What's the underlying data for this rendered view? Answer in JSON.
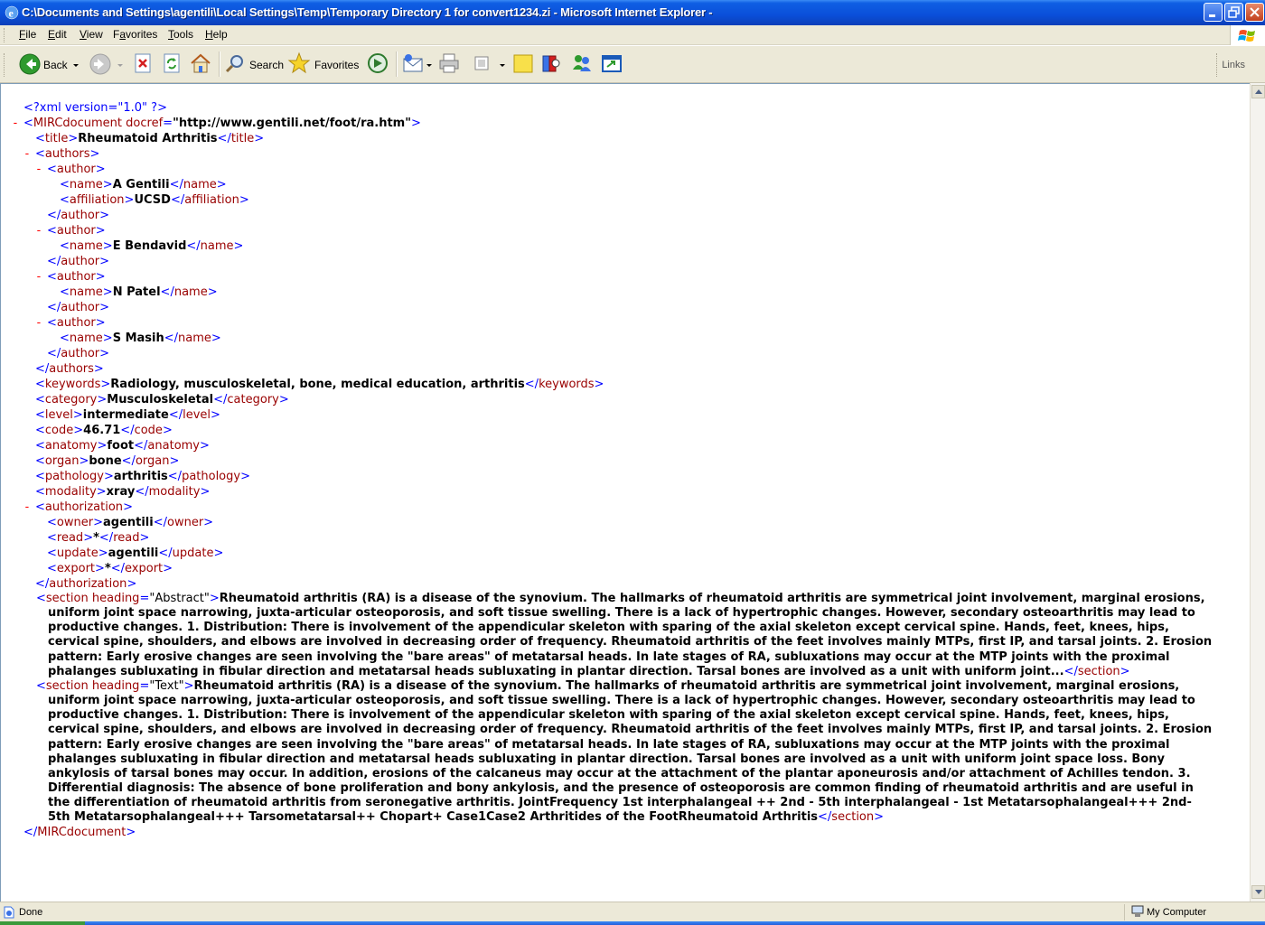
{
  "window": {
    "title": "C:\\Documents and Settings\\agentili\\Local Settings\\Temp\\Temporary Directory 1 for convert1234.zi - Microsoft Internet Explorer",
    "title_short": "C:\\Documents and Settings\\agentili\\Local Settings\\Temp\\Temporary Directory 1 for convert1234.zi - Microsoft Internet Explorer -",
    "icon": "ie-icon"
  },
  "menu": {
    "file": {
      "hot": "F",
      "rest": "ile"
    },
    "edit": {
      "hot": "E",
      "rest": "dit"
    },
    "view": {
      "hot": "V",
      "rest": "iew"
    },
    "favorites": {
      "pre": "F",
      "hot": "a",
      "rest": "vorites"
    },
    "tools": {
      "hot": "T",
      "rest": "ools"
    },
    "help": {
      "hot": "H",
      "rest": "elp"
    }
  },
  "toolbar": {
    "back": "Back",
    "search": "Search",
    "favorites": "Favorites",
    "links": "Links"
  },
  "status": {
    "text": "Done",
    "zone": "My Computer"
  },
  "xml": {
    "decl": "<?xml version=\"1.0\" ?>",
    "root_open_tag": "MIRCdocument",
    "root_attr": "docref",
    "root_attr_value": "\"http://www.gentili.net/foot/ra.htm\"",
    "title": "Rheumatoid Arthritis",
    "authors": [
      {
        "name": "A Gentili",
        "affiliation": "UCSD"
      },
      {
        "name": "E Bendavid"
      },
      {
        "name": "N Patel"
      },
      {
        "name": "S Masih"
      }
    ],
    "keywords": "Radiology, musculoskeletal, bone, medical education, arthritis",
    "category": "Musculoskeletal",
    "level": "intermediate",
    "code": "46.71",
    "anatomy": "foot",
    "organ": "bone",
    "pathology": "arthritis",
    "modality": "xray",
    "authorization": {
      "owner": "agentili",
      "read": "*",
      "update": "agentili",
      "export": "*"
    },
    "sections": [
      {
        "heading": "\"Abstract\"",
        "text": "Rheumatoid arthritis (RA) is a disease of the synovium. The hallmarks of rheumatoid arthritis are symmetrical joint involvement, marginal erosions, uniform joint space narrowing, juxta-articular osteoporosis, and soft tissue swelling. There is a lack of hypertrophic changes. However, secondary osteoarthritis may lead to productive changes. 1. Distribution: There is involvement of the appendicular skeleton with sparing of the axial skeleton except cervical spine. Hands, feet, knees, hips, cervical spine, shoulders, and elbows are involved in decreasing order of frequency. Rheumatoid arthritis of the feet involves mainly MTPs, first IP, and tarsal joints. 2. Erosion pattern: Early erosive changes are seen involving the \"bare areas\" of metatarsal heads. In late stages of RA, subluxations may occur at the MTP joints with the proximal phalanges subluxating in fibular direction and metatarsal heads subluxating in plantar direction. Tarsal bones are involved as a unit with uniform joint..."
      },
      {
        "heading": "\"Text\"",
        "text": "Rheumatoid arthritis (RA) is a disease of the synovium. The hallmarks of rheumatoid arthritis are symmetrical joint involvement, marginal erosions, uniform joint space narrowing, juxta-articular osteoporosis, and soft tissue swelling. There is a lack of hypertrophic changes. However, secondary osteoarthritis may lead to productive changes. 1. Distribution: There is involvement of the appendicular skeleton with sparing of the axial skeleton except cervical spine. Hands, feet, knees, hips, cervical spine, shoulders, and elbows are involved in decreasing order of frequency. Rheumatoid arthritis of the feet involves mainly MTPs, first IP, and tarsal joints. 2. Erosion pattern: Early erosive changes are seen involving the \"bare areas\" of metatarsal heads. In late stages of RA, subluxations may occur at the MTP joints with the proximal phalanges subluxating in fibular direction and metatarsal heads subluxating in plantar direction. Tarsal bones are involved as a unit with uniform joint space loss. Bony ankylosis of tarsal bones may occur. In addition, erosions of the calcaneus may occur at the attachment of the plantar aponeurosis and/or attachment of Achilles tendon. 3. Differential diagnosis: The absence of bone proliferation and bony ankylosis, and the presence of osteoporosis are common finding of rheumatoid arthritis and are useful in the differentiation of rheumatoid arthritis from seronegative arthritis. JointFrequency 1st interphalangeal ++ 2nd - 5th interphalangeal - 1st Metatarsophalangeal+++ 2nd-5th Metatarsophalangeal+++ Tarsometatarsal++ Chopart+ Case1Case2 Arthritides of the FootRheumatoid Arthritis"
      }
    ]
  }
}
